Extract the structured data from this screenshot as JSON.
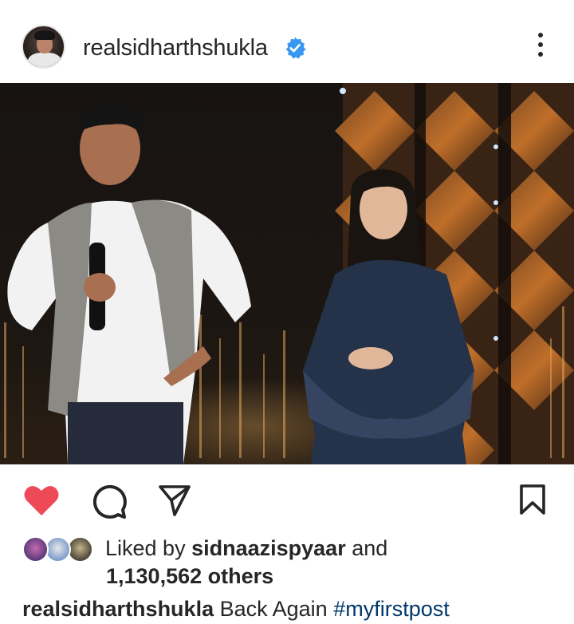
{
  "post": {
    "username": "realsidharthshukla",
    "verified_icon": "verified-badge-icon",
    "more_icon": "more-vertical-icon"
  },
  "photo": {
    "alt_subject": "two people on a stage"
  },
  "actions": {
    "like_icon": "heart-filled-icon",
    "comment_icon": "comment-bubble-icon",
    "share_icon": "send-paper-plane-icon",
    "save_icon": "bookmark-icon",
    "like_color": "#ed4956"
  },
  "likes": {
    "prefix": "Liked by",
    "user": "sidnaazispyaar",
    "and": "and",
    "count": "1,130,562 others"
  },
  "caption": {
    "username": "realsidharthshukla",
    "text": "Back Again",
    "hashtag": "#myfirstpost"
  }
}
